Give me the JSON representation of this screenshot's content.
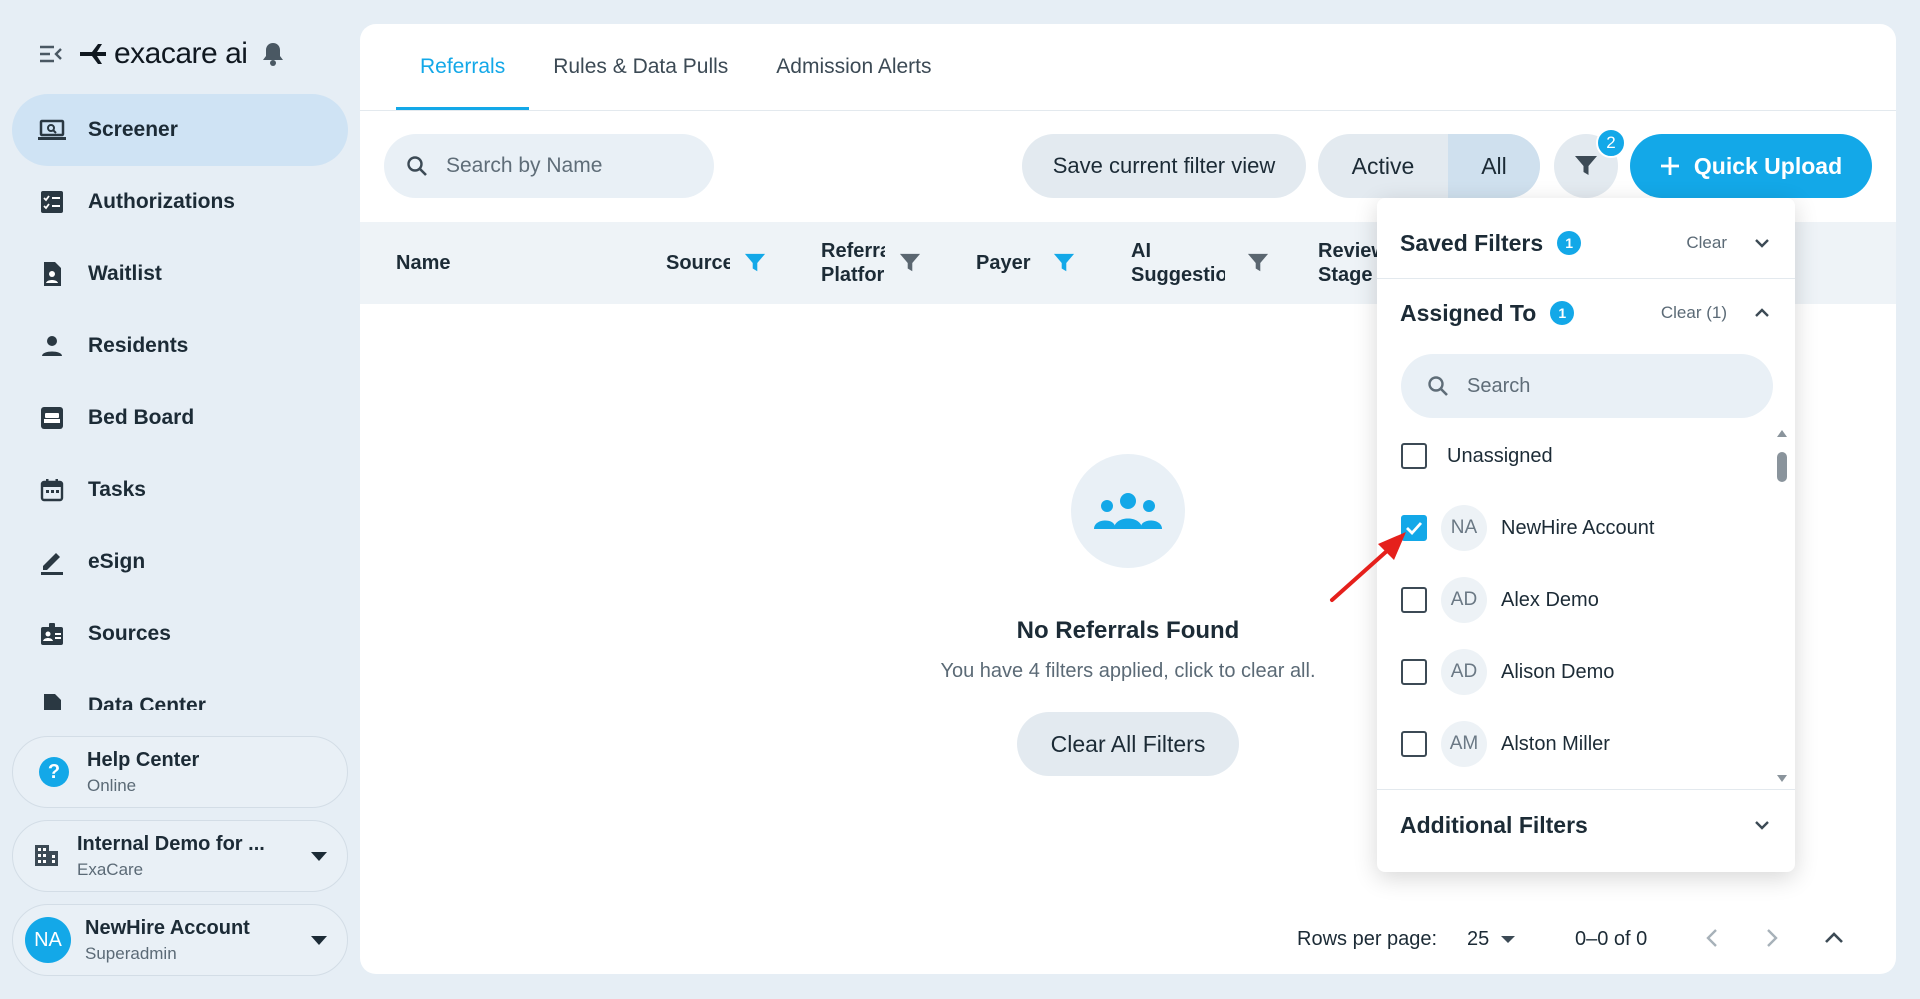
{
  "sidebar": {
    "brand": "exacare ai",
    "nav": [
      {
        "label": "Screener",
        "icon": "laptop-icon",
        "active": true
      },
      {
        "label": "Authorizations",
        "icon": "checklist-icon"
      },
      {
        "label": "Waitlist",
        "icon": "waitlist-icon"
      },
      {
        "label": "Residents",
        "icon": "person-icon"
      },
      {
        "label": "Bed Board",
        "icon": "bed-icon"
      },
      {
        "label": "Tasks",
        "icon": "calendar-icon"
      },
      {
        "label": "eSign",
        "icon": "pen-icon"
      },
      {
        "label": "Sources",
        "icon": "badge-icon"
      },
      {
        "label": "Data Center",
        "icon": "database-icon"
      }
    ],
    "help": {
      "title": "Help Center",
      "status": "Online"
    },
    "org": {
      "name": "Internal Demo for ...",
      "sub": "ExaCare"
    },
    "user": {
      "initials": "NA",
      "name": "NewHire Account",
      "role": "Superadmin"
    }
  },
  "tabs": [
    "Referrals",
    "Rules & Data Pulls",
    "Admission Alerts"
  ],
  "toolbar": {
    "search_placeholder": "Search by Name",
    "save_view": "Save current filter view",
    "segment_active": "Active",
    "segment_all": "All",
    "filter_count": "2",
    "quick_upload": "Quick Upload"
  },
  "table": {
    "headers": [
      "Name",
      "Source",
      "Referral Platform",
      "Payer",
      "AI Suggestion",
      "Review Stage"
    ]
  },
  "empty": {
    "title": "No Referrals Found",
    "subtitle": "You have 4 filters applied, click to clear all.",
    "button": "Clear All Filters"
  },
  "footer": {
    "rows_per_page_label": "Rows per page:",
    "rows_per_page": "25",
    "range": "0–0 of 0"
  },
  "filter_panel": {
    "saved_filters": {
      "title": "Saved Filters",
      "badge": "1",
      "clear": "Clear"
    },
    "assigned_to": {
      "title": "Assigned To",
      "badge": "1",
      "clear": "Clear (1)"
    },
    "search_placeholder": "Search",
    "options": [
      {
        "initials": "",
        "name": "Unassigned",
        "checked": false
      },
      {
        "initials": "NA",
        "name": "NewHire Account",
        "checked": true
      },
      {
        "initials": "AD",
        "name": "Alex Demo",
        "checked": false
      },
      {
        "initials": "AD",
        "name": "Alison Demo",
        "checked": false
      },
      {
        "initials": "AM",
        "name": "Alston Miller",
        "checked": false
      }
    ],
    "additional_filters": "Additional Filters"
  },
  "colors": {
    "accent": "#13a8e8",
    "annotation": "#e5201c"
  }
}
